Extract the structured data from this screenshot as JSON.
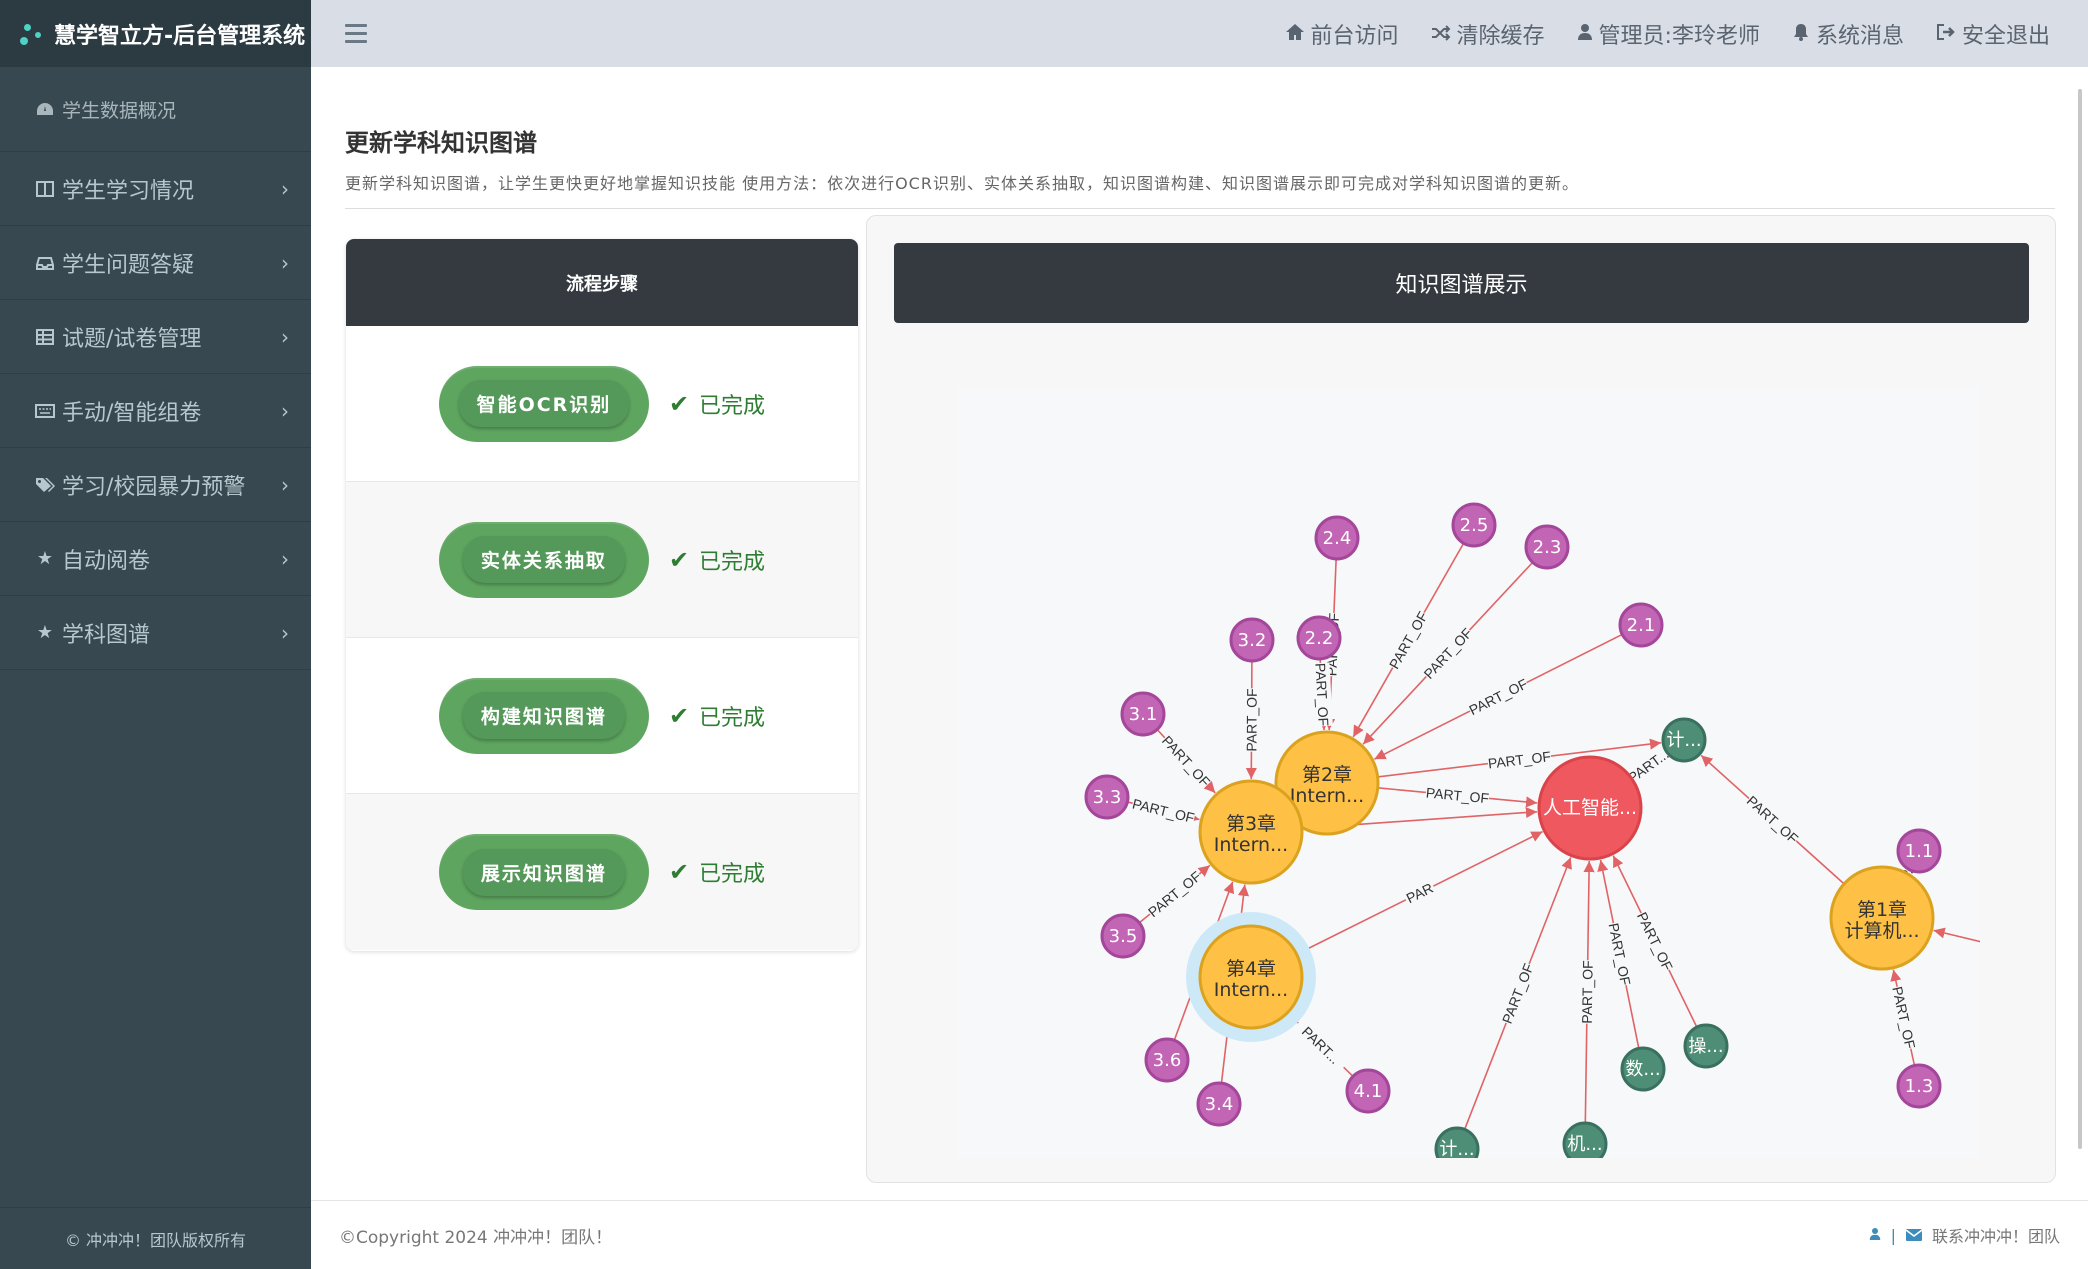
{
  "brand": {
    "title": "慧学智立方-后台管理系统"
  },
  "sidebar": {
    "items": [
      {
        "label": "学生数据概况",
        "icon": "dashboard-icon"
      },
      {
        "label": "学生学习情况",
        "icon": "columns-icon"
      },
      {
        "label": "学生问题答疑",
        "icon": "inbox-icon"
      },
      {
        "label": "试题/试卷管理",
        "icon": "table-icon"
      },
      {
        "label": "手动/智能组卷",
        "icon": "keyboard-icon"
      },
      {
        "label": "学习/校园暴力预警",
        "icon": "tags-icon"
      },
      {
        "label": "自动阅卷",
        "icon": "star-icon"
      },
      {
        "label": "学科图谱",
        "icon": "star-icon"
      }
    ],
    "footer": "© 冲冲冲！团队版权所有"
  },
  "topbar": {
    "links": [
      {
        "label": "前台访问",
        "icon": "home-icon"
      },
      {
        "label": "清除缓存",
        "icon": "shuffle-icon"
      },
      {
        "label": "管理员:李玲老师",
        "icon": "user-icon"
      },
      {
        "label": "系统消息",
        "icon": "bell-icon"
      },
      {
        "label": "安全退出",
        "icon": "signout-icon"
      }
    ]
  },
  "page": {
    "title": "更新学科知识图谱",
    "desc": "更新学科知识图谱，让学生更快更好地掌握知识技能 使用方法：依次进行OCR识别、实体关系抽取，知识图谱构建、知识图谱展示即可完成对学科知识图谱的更新。"
  },
  "steps": {
    "header": "流程步骤",
    "items": [
      {
        "label": "智能OCR识别",
        "status": "已完成"
      },
      {
        "label": "实体关系抽取",
        "status": "已完成"
      },
      {
        "label": "构建知识图谱",
        "status": "已完成"
      },
      {
        "label": "展示知识图谱",
        "status": "已完成"
      }
    ]
  },
  "graph": {
    "header": "知识图谱展示",
    "colors": {
      "section": "#c165b4",
      "chapter": "#ffc145",
      "root": "#f0585f",
      "topic": "#4e8e76",
      "edge": "#e06366",
      "halo": "#cde9f8"
    },
    "nodes": [
      {
        "id": "root",
        "label": "人工智能...",
        "kind": "root"
      },
      {
        "id": "ch1",
        "label": "第1章",
        "sub": "计算机...",
        "kind": "chapter"
      },
      {
        "id": "ch2",
        "label": "第2章",
        "sub": "Intern...",
        "kind": "chapter"
      },
      {
        "id": "ch3",
        "label": "第3章",
        "sub": "Intern...",
        "kind": "chapter"
      },
      {
        "id": "ch4",
        "label": "第4章",
        "sub": "Intern...",
        "kind": "chapter",
        "selected": true
      },
      {
        "id": "s24",
        "label": "2.4",
        "kind": "section"
      },
      {
        "id": "s25",
        "label": "2.5",
        "kind": "section"
      },
      {
        "id": "s23",
        "label": "2.3",
        "kind": "section"
      },
      {
        "id": "s21",
        "label": "2.1",
        "kind": "section"
      },
      {
        "id": "s22",
        "label": "2.2",
        "kind": "section"
      },
      {
        "id": "s32",
        "label": "3.2",
        "kind": "section"
      },
      {
        "id": "s31",
        "label": "3.1",
        "kind": "section"
      },
      {
        "id": "s33",
        "label": "3.3",
        "kind": "section"
      },
      {
        "id": "s35",
        "label": "3.5",
        "kind": "section"
      },
      {
        "id": "s36",
        "label": "3.6",
        "kind": "section"
      },
      {
        "id": "s34",
        "label": "3.4",
        "kind": "section"
      },
      {
        "id": "s41",
        "label": "4.1",
        "kind": "section"
      },
      {
        "id": "s11",
        "label": "1.1",
        "kind": "section"
      },
      {
        "id": "s13",
        "label": "1.3",
        "kind": "section"
      },
      {
        "id": "t1",
        "label": "计...",
        "kind": "topic"
      },
      {
        "id": "t2",
        "label": "计...",
        "kind": "topic"
      },
      {
        "id": "t3",
        "label": "机...",
        "kind": "topic"
      },
      {
        "id": "t4",
        "label": "数...",
        "kind": "topic"
      },
      {
        "id": "t5",
        "label": "操...",
        "kind": "topic"
      }
    ],
    "edges": [
      {
        "from": "s24",
        "to": "ch2",
        "label": "PART_OF"
      },
      {
        "from": "s25",
        "to": "ch2",
        "label": "PART_OF"
      },
      {
        "from": "s23",
        "to": "ch2",
        "label": "PART_OF"
      },
      {
        "from": "s21",
        "to": "ch2",
        "label": "PART_OF"
      },
      {
        "from": "s22",
        "to": "ch2",
        "label": "PART_OF"
      },
      {
        "from": "s32",
        "to": "ch3",
        "label": "PART_OF"
      },
      {
        "from": "s31",
        "to": "ch3",
        "label": "PART_OF"
      },
      {
        "from": "s33",
        "to": "ch3",
        "label": "PART_OF"
      },
      {
        "from": "s35",
        "to": "ch3",
        "label": "PART_OF"
      },
      {
        "from": "s36",
        "to": "ch3",
        "label": "PART_OF"
      },
      {
        "from": "s34",
        "to": "ch3",
        "label": "PART_OF"
      },
      {
        "from": "s41",
        "to": "ch4",
        "label": "PART..."
      },
      {
        "from": "ch2",
        "to": "root",
        "label": "PART_OF"
      },
      {
        "from": "ch3",
        "to": "root",
        "label": ""
      },
      {
        "from": "ch4",
        "to": "root",
        "label": "PAR"
      },
      {
        "from": "ch2",
        "to": "t1",
        "label": "PART_OF"
      },
      {
        "from": "root",
        "to": "t1",
        "label": "PART..."
      },
      {
        "from": "ch1",
        "to": "t1",
        "label": "PART_OF"
      },
      {
        "from": "t2",
        "to": "root",
        "label": "PART_OF"
      },
      {
        "from": "t3",
        "to": "root",
        "label": "PART_OF"
      },
      {
        "from": "t4",
        "to": "root",
        "label": "PART_OF"
      },
      {
        "from": "t5",
        "to": "root",
        "label": "PART_OF"
      },
      {
        "from": "s11",
        "to": "ch1",
        "label": "P..."
      },
      {
        "from": "s13",
        "to": "ch1",
        "label": "PART_OF"
      },
      {
        "from": "offscreen",
        "to": "ch1",
        "label": ""
      }
    ]
  },
  "footer": {
    "copyright": "©Copyright 2024 冲冲冲！团队！",
    "contact": "联系冲冲冲！团队"
  }
}
